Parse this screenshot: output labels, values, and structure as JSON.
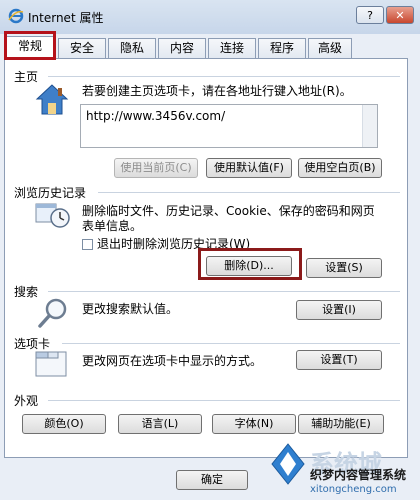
{
  "window": {
    "title": "Internet 属性",
    "help_label": "?",
    "close_label": "✕"
  },
  "tabs": [
    {
      "label": "常规",
      "active": true
    },
    {
      "label": "安全"
    },
    {
      "label": "隐私"
    },
    {
      "label": "内容"
    },
    {
      "label": "连接"
    },
    {
      "label": "程序"
    },
    {
      "label": "高级"
    }
  ],
  "homepage": {
    "heading": "主页",
    "instruction": "若要创建主页选项卡，请在各地址行键入地址(R)。",
    "url": "http://www.3456v.com/",
    "buttons": {
      "use_current": "使用当前页(C)",
      "use_default": "使用默认值(F)",
      "use_blank": "使用空白页(B)"
    }
  },
  "history": {
    "heading": "浏览历史记录",
    "description_line1": "删除临时文件、历史记录、Cookie、保存的密码和网页",
    "description_line2": "表单信息。",
    "checkbox_label": "退出时删除浏览历史记录(W)",
    "delete_button": "删除(D)...",
    "settings_button": "设置(S)"
  },
  "search": {
    "heading": "搜索",
    "description": "更改搜索默认值。",
    "settings_button": "设置(I)"
  },
  "tabs_section": {
    "heading": "选项卡",
    "description": "更改网页在选项卡中显示的方式。",
    "settings_button": "设置(T)"
  },
  "appearance": {
    "heading": "外观",
    "buttons": {
      "colors": "颜色(O)",
      "languages": "语言(L)",
      "fonts": "字体(N)",
      "accessibility": "辅助功能(E)"
    }
  },
  "footer": {
    "ok_button": "确定"
  },
  "watermark": {
    "line1": "织梦内容管理系统",
    "url": "xitongcheng.com",
    "big": "系统城"
  },
  "colors": {
    "highlight": "#b5121b",
    "titlebar": "#c7d6ea"
  }
}
